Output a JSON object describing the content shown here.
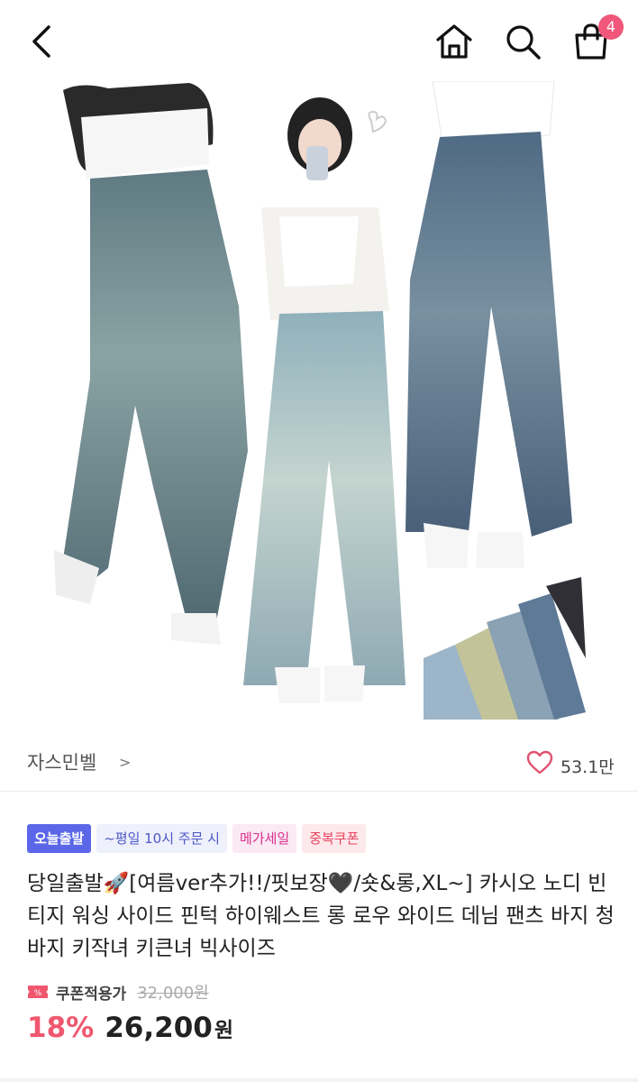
{
  "header": {
    "cart_count": "4",
    "icons": [
      "back-arrow",
      "home",
      "search",
      "shopping-bag"
    ]
  },
  "product_image": {
    "description_icons": [
      "model-photo"
    ]
  },
  "seller": {
    "name": "자스민벨",
    "chevron": ">",
    "like_count": "53.1만"
  },
  "badges": {
    "today": "오늘출발",
    "time": "~평일 10시 주문 시",
    "mega_sale": "메가세일",
    "coupon": "중복쿠폰"
  },
  "product": {
    "title": "당일출발🚀[여름ver추가!!/핏보장🖤/숏&롱,XL~] 카시오 노디 빈티지 워싱 사이드 핀턱 하이웨스트 롱 로우 와이드 데님 팬츠 바지 청바지 키작녀 키큰녀 빅사이즈"
  },
  "price": {
    "coupon_label": "쿠폰적용가",
    "original": "32,000원",
    "discount": "18%",
    "value": "26,200",
    "unit": "원"
  },
  "colors": {
    "accent_pink": "#f0577a",
    "discount_red": "#f0576e",
    "badge_blue": "#5b67e8"
  }
}
